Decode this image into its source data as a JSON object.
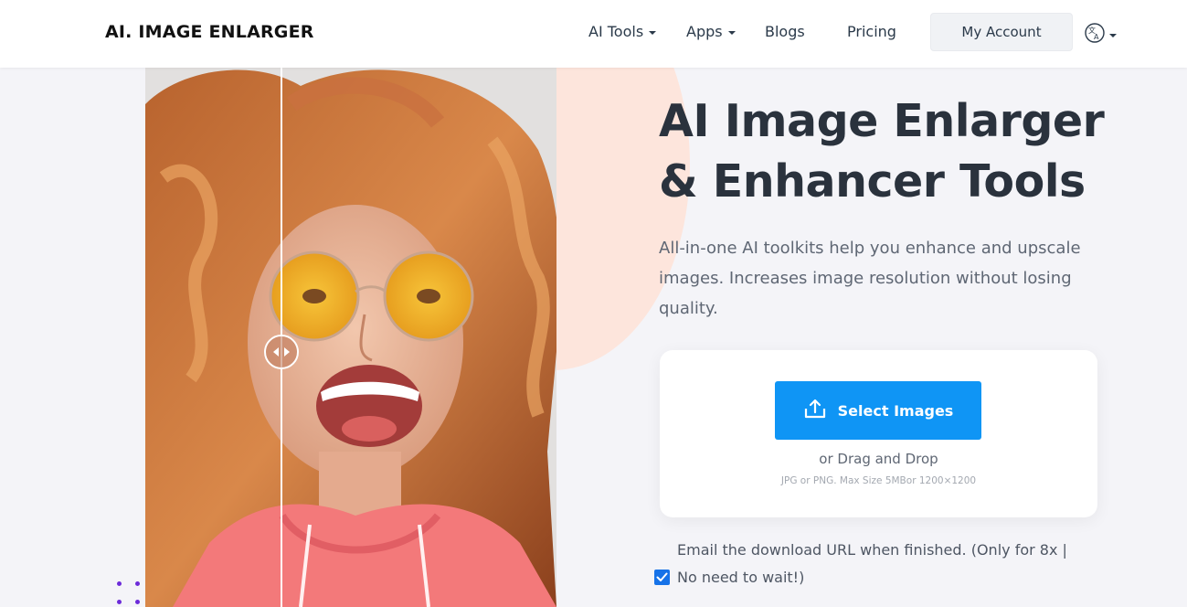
{
  "header": {
    "logo": "AI. IMAGE ENLARGER",
    "nav": {
      "ai_tools": "AI Tools",
      "apps": "Apps",
      "blogs": "Blogs",
      "pricing": "Pricing"
    },
    "account_button": "My Account",
    "language_icon": "translate-icon"
  },
  "hero": {
    "title_line1": "AI Image Enlarger",
    "title_line2": "& Enhancer Tools",
    "subtitle": "All-in-one AI toolkits help you enhance and upscale images. Increases image resolution without losing quality."
  },
  "compare": {
    "handle_icon": "compare-slider-icon"
  },
  "upload": {
    "button_label": "Select Images",
    "button_icon": "upload-icon",
    "drag_text": "or Drag and Drop",
    "size_text": "JPG or PNG. Max Size 5MBor 1200×1200"
  },
  "email_option": {
    "line1": "Email the download URL when finished. (Only for 8x |",
    "line2": "No need to wait!)",
    "checked": true
  },
  "colors": {
    "accent": "#0f95f5",
    "checkbox": "#1672e8",
    "peach": "#fde5dc",
    "dots": "#6c2bd9"
  }
}
